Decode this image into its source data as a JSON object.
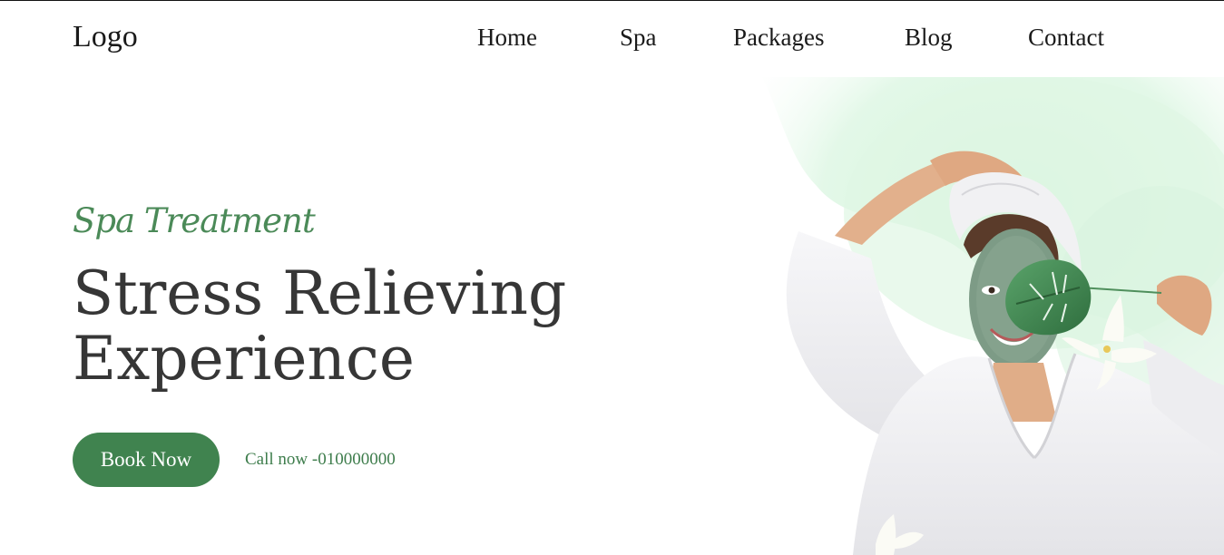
{
  "nav": {
    "logo": "Logo",
    "links": [
      {
        "label": "Home"
      },
      {
        "label": "Spa"
      },
      {
        "label": "Packages"
      },
      {
        "label": "Blog"
      },
      {
        "label": "Contact"
      }
    ]
  },
  "hero": {
    "eyebrow": "Spa Treatment",
    "headline_line1": "Stress Relieving",
    "headline_line2": "Experience",
    "cta_label": "Book Now",
    "call_text": "Call now -010000000",
    "image_icon": "spa-woman-face-mask-photo"
  },
  "colors": {
    "accent_green": "#40834f",
    "heading_text": "#363636",
    "nav_text": "#1a1a1a",
    "wash_green": "#d7f3dd"
  }
}
